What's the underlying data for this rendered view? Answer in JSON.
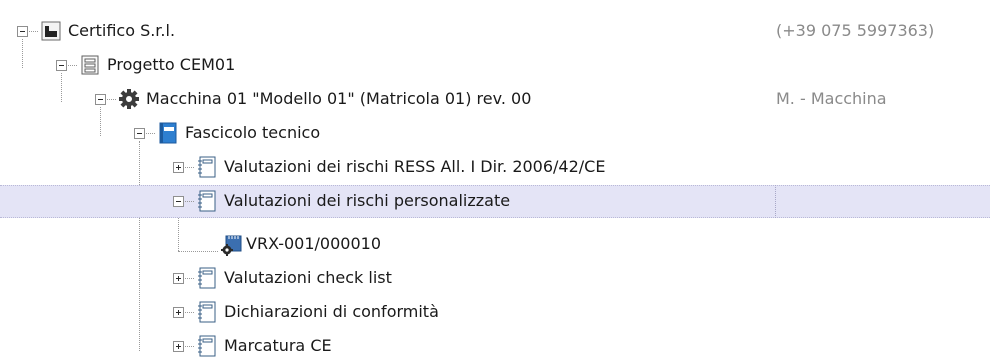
{
  "tree": {
    "nodes": [
      {
        "label": "Certifico S.r.l.",
        "right": "(+39 075 5997363)",
        "icon": "company-icon",
        "expanded": true
      },
      {
        "label": "Progetto CEM01",
        "icon": "project-icon",
        "expanded": true
      },
      {
        "label": "Macchina 01 \"Modello 01\" (Matricola 01) rev. 00",
        "right": "M. - Macchina",
        "icon": "gear-icon",
        "expanded": true
      },
      {
        "label": "Fascicolo tecnico",
        "icon": "binder-icon",
        "expanded": true
      },
      {
        "label": "Valutazioni dei rischi RESS All. I Dir. 2006/42/CE",
        "icon": "notebook-icon",
        "expanded": false
      },
      {
        "label": "Valutazioni dei rischi personalizzate",
        "icon": "notebook-icon",
        "expanded": true,
        "selected": true
      },
      {
        "label": "VRX-001/000010",
        "icon": "document-gear-icon",
        "leaf": true
      },
      {
        "label": "Valutazioni check list",
        "icon": "notebook-icon",
        "expanded": false
      },
      {
        "label": "Dichiarazioni di conformità",
        "icon": "notebook-icon",
        "expanded": false
      },
      {
        "label": "Marcatura CE",
        "icon": "notebook-icon",
        "expanded": false
      }
    ]
  },
  "colors": {
    "selection": "#e4e4f6",
    "secondary_text": "#8a8a8a",
    "binder_blue": "#2e7fd0"
  }
}
